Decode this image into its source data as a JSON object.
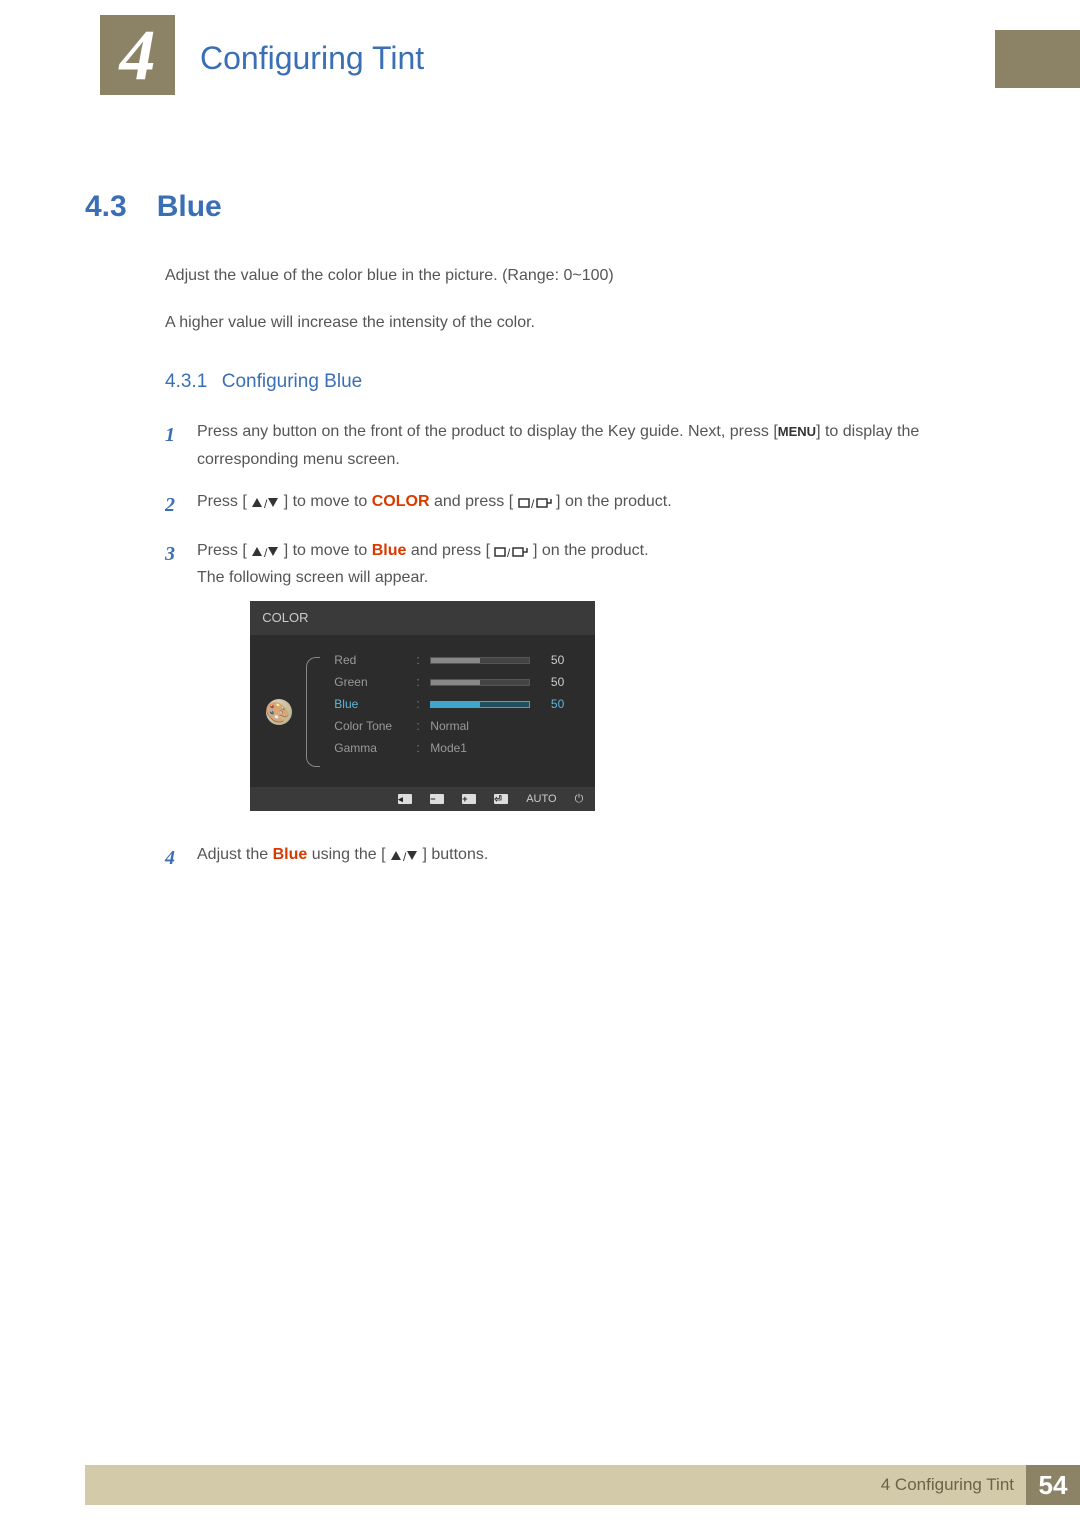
{
  "chapter": {
    "number": "4",
    "title": "Configuring Tint"
  },
  "section": {
    "number": "4.3",
    "title": "Blue"
  },
  "intro": {
    "p1": "Adjust the value of the color blue in the picture. (Range: 0~100)",
    "p2": "A higher value will increase the intensity of the color."
  },
  "subsection": {
    "number": "4.3.1",
    "title": "Configuring Blue"
  },
  "steps": {
    "s1": {
      "num": "1",
      "pre": "Press any button on the front of the product to display the Key guide. Next, press [",
      "menu": "MENU",
      "post": "] to display the corresponding menu screen."
    },
    "s2": {
      "num": "2",
      "pre": "Press [",
      "mid": "] to move to ",
      "color": "COLOR",
      "mid2": " and press [",
      "post": "] on the product."
    },
    "s3": {
      "num": "3",
      "pre": "Press [",
      "mid": "] to move to ",
      "color": "Blue",
      "mid2": " and press [",
      "post": "] on the product.",
      "after": "The following screen will appear."
    },
    "s4": {
      "num": "4",
      "pre": "Adjust the ",
      "color": "Blue",
      "mid": " using the [",
      "post": "] buttons."
    }
  },
  "osd": {
    "header": "COLOR",
    "rows": {
      "red": {
        "label": "Red",
        "value": "50"
      },
      "green": {
        "label": "Green",
        "value": "50"
      },
      "blue": {
        "label": "Blue",
        "value": "50"
      },
      "tone": {
        "label": "Color Tone",
        "value": "Normal"
      },
      "gamma": {
        "label": "Gamma",
        "value": "Mode1"
      }
    },
    "footer": {
      "auto": "AUTO"
    }
  },
  "footer": {
    "label": "4 Configuring Tint",
    "page": "54"
  }
}
